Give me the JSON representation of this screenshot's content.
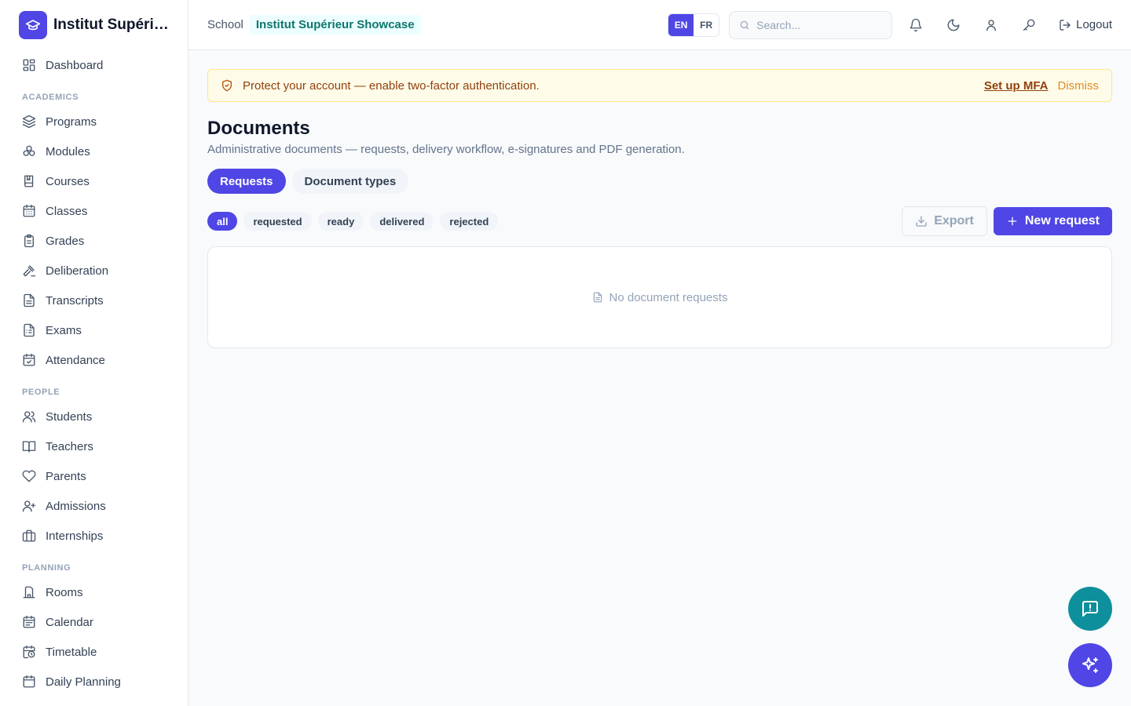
{
  "brand": {
    "name": "Institut Supérieur Showcase",
    "logo_icon": "graduation-cap-icon",
    "color": "#4f46e5"
  },
  "sidebar": {
    "items": [
      {
        "label": "Dashboard",
        "icon": "dashboard-icon"
      },
      {
        "section": "ACADEMICS"
      },
      {
        "label": "Programs",
        "icon": "layers-icon"
      },
      {
        "label": "Modules",
        "icon": "boxes-icon"
      },
      {
        "label": "Courses",
        "icon": "book-icon"
      },
      {
        "label": "Classes",
        "icon": "calendar-grid-icon"
      },
      {
        "label": "Grades",
        "icon": "clipboard-icon"
      },
      {
        "label": "Deliberation",
        "icon": "gavel-icon"
      },
      {
        "label": "Transcripts",
        "icon": "file-text-icon"
      },
      {
        "label": "Exams",
        "icon": "file-check-icon"
      },
      {
        "label": "Attendance",
        "icon": "calendar-check-icon"
      },
      {
        "section": "PEOPLE"
      },
      {
        "label": "Students",
        "icon": "users-icon"
      },
      {
        "label": "Teachers",
        "icon": "open-book-icon"
      },
      {
        "label": "Parents",
        "icon": "heart-icon"
      },
      {
        "label": "Admissions",
        "icon": "user-plus-icon"
      },
      {
        "label": "Internships",
        "icon": "briefcase-icon"
      },
      {
        "section": "PLANNING"
      },
      {
        "label": "Rooms",
        "icon": "building-icon"
      },
      {
        "label": "Calendar",
        "icon": "calendar-icon"
      },
      {
        "label": "Timetable",
        "icon": "calendar-clock-icon"
      },
      {
        "label": "Daily Planning",
        "icon": "calendar-list-icon"
      }
    ]
  },
  "header": {
    "school_label": "School",
    "school_name": "Institut Supérieur Showcase",
    "languages": [
      "EN",
      "FR"
    ],
    "active_language": "EN",
    "search_placeholder": "Search...",
    "logout_label": "Logout"
  },
  "banner": {
    "text": "Protect your account — enable two-factor authentication.",
    "action": "Set up MFA",
    "dismiss": "Dismiss"
  },
  "page": {
    "title": "Documents",
    "subtitle": "Administrative documents — requests, delivery workflow, e-signatures and PDF generation.",
    "tabs": [
      "Requests",
      "Document types"
    ],
    "active_tab": "Requests",
    "filters": [
      "all",
      "requested",
      "ready",
      "delivered",
      "rejected"
    ],
    "active_filter": "all",
    "export_label": "Export",
    "new_request_label": "New request",
    "empty_text": "No document requests"
  },
  "colors": {
    "accent": "#4f46e5",
    "teal": "#0e8f9c",
    "banner_bg": "#fefce8"
  }
}
